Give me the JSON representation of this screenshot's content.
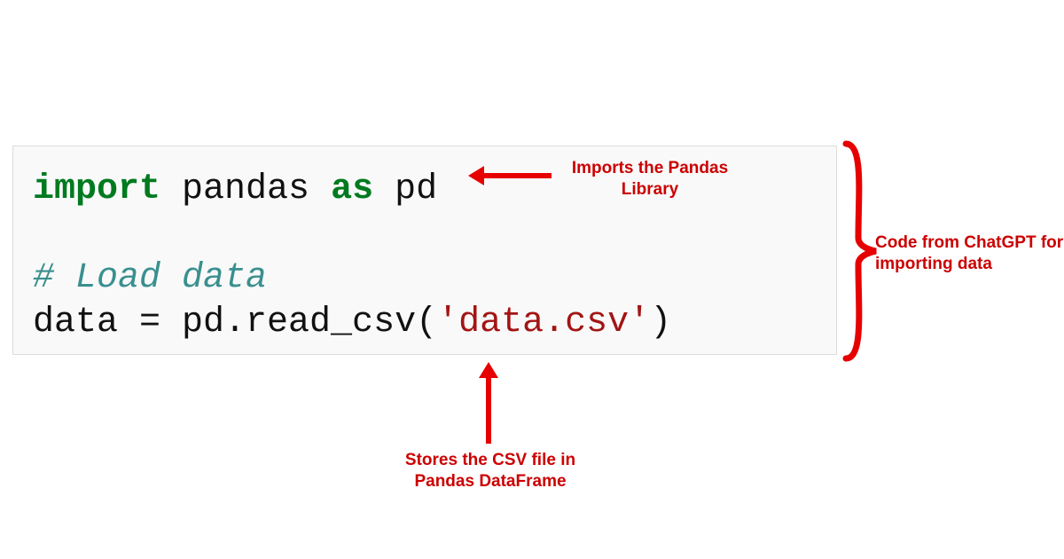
{
  "code": {
    "line1": {
      "kw_import": "import",
      "ident_pandas": " pandas ",
      "kw_as": "as",
      "ident_pd": " pd"
    },
    "blank": " ",
    "comment": "# Load data",
    "line4": {
      "lhs": "data = pd.read_csv(",
      "str": "'data.csv'",
      "rhs": ")"
    }
  },
  "annotations": {
    "top": "Imports the Pandas Library",
    "right": "Code from ChatGPT for importing data",
    "bottom": "Stores the CSV file in Pandas DataFrame"
  },
  "colors": {
    "annotation": "#cc0000",
    "keyword": "#007a1f",
    "comment": "#3a8f8f",
    "string": "#a31414"
  }
}
